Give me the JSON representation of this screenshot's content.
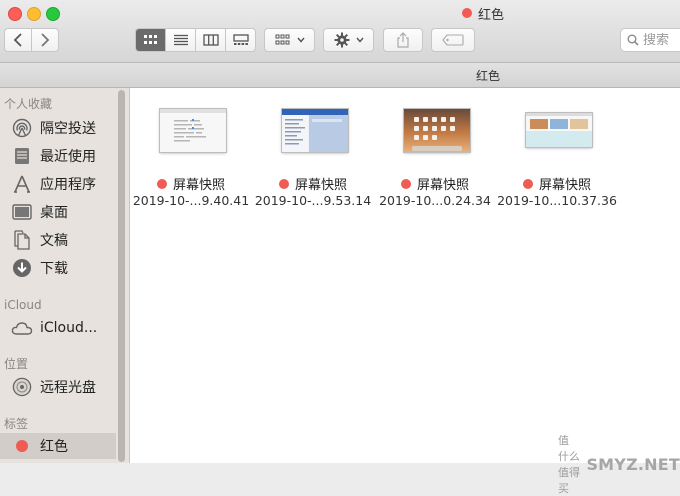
{
  "window": {
    "title": "红色",
    "title_tag_color": "#f25a53"
  },
  "toolbar": {
    "back": "chevron-left-icon",
    "forward": "chevron-right-icon",
    "view_modes": [
      "icon-view",
      "list-view",
      "column-view",
      "gallery-view"
    ],
    "active_view": "icon-view",
    "arrange": "arrange-grid-icon",
    "action": "gear-icon",
    "share": "share-icon",
    "tags": "tag-icon",
    "search_placeholder": "搜索"
  },
  "pathbar": {
    "label": "红色"
  },
  "sidebar": {
    "sections": [
      {
        "heading": "个人收藏",
        "items": [
          {
            "label": "隔空投送",
            "icon": "airdrop-icon"
          },
          {
            "label": "最近使用",
            "icon": "recents-icon"
          },
          {
            "label": "应用程序",
            "icon": "applications-icon"
          },
          {
            "label": "桌面",
            "icon": "desktop-icon"
          },
          {
            "label": "文稿",
            "icon": "documents-icon"
          },
          {
            "label": "下载",
            "icon": "downloads-icon"
          }
        ]
      },
      {
        "heading": "iCloud",
        "items": [
          {
            "label": "iCloud...",
            "icon": "icloud-icon"
          }
        ]
      },
      {
        "heading": "位置",
        "items": [
          {
            "label": "远程光盘",
            "icon": "remote-disc-icon"
          }
        ]
      },
      {
        "heading": "标签",
        "items": [
          {
            "label": "红色",
            "icon": "red-tag-dot",
            "selected": true
          }
        ]
      }
    ],
    "tag_color": "#ef5b55"
  },
  "files": [
    {
      "name": "屏幕快照",
      "date": "2019-10-...9.40.41",
      "tag_color": "#ef5b55"
    },
    {
      "name": "屏幕快照",
      "date": "2019-10-...9.53.14",
      "tag_color": "#ef5b55"
    },
    {
      "name": "屏幕快照",
      "date": "2019-10...0.24.34",
      "tag_color": "#ef5b55"
    },
    {
      "name": "屏幕快照",
      "date": "2019-10...10.37.36",
      "tag_color": "#ef5b55"
    }
  ],
  "watermark": {
    "text": "SMYZ.NET",
    "subtext": "值 什么值得买"
  }
}
